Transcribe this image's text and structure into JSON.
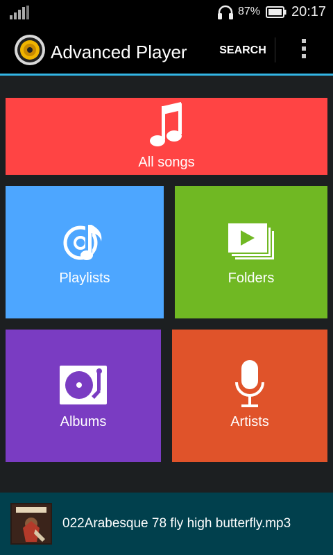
{
  "status_bar": {
    "battery_percent": "87%",
    "time": "20:17",
    "icons": [
      "signal-icon",
      "headphones-icon",
      "battery-icon"
    ]
  },
  "action_bar": {
    "title": "Advanced Player",
    "search_label": "SEARCH",
    "icons": [
      "speaker-app-icon",
      "overflow-menu-icon"
    ]
  },
  "tiles": [
    {
      "label": "All songs",
      "icon": "music-note-icon",
      "color": "#ff4444"
    },
    {
      "label": "Playlists",
      "icon": "playlist-icon",
      "color": "#4da6ff"
    },
    {
      "label": "Folders",
      "icon": "folder-video-icon",
      "color": "#70b823"
    },
    {
      "label": "Albums",
      "icon": "turntable-icon",
      "color": "#7a3cc2"
    },
    {
      "label": "Artists",
      "icon": "microphone-icon",
      "color": "#e0532a"
    }
  ],
  "now_playing": {
    "track": "022Arabesque 78 fly high butterfly.mp3",
    "color": "#01404d"
  },
  "colors": {
    "accent": "#33b5e5",
    "content_bg": "#1c1f21"
  }
}
